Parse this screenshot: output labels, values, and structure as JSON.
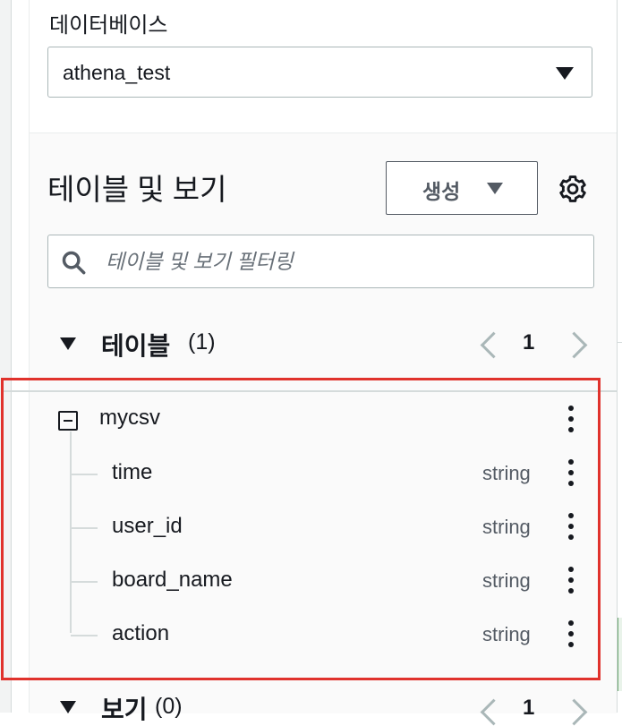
{
  "database": {
    "label": "데이터베이스",
    "selected": "athena_test"
  },
  "tables_panel": {
    "title": "테이블 및 보기",
    "create_label": "생성",
    "filter_placeholder": "테이블 및 보기 필터링"
  },
  "tables_group": {
    "title": "테이블",
    "count": "(1)",
    "page": "1",
    "table": {
      "name": "mycsv",
      "columns": [
        {
          "name": "time",
          "type": "string"
        },
        {
          "name": "user_id",
          "type": "string"
        },
        {
          "name": "board_name",
          "type": "string"
        },
        {
          "name": "action",
          "type": "string"
        }
      ]
    }
  },
  "views_group": {
    "title": "보기",
    "count": "(0)",
    "page": "1"
  },
  "colors": {
    "highlight": "#e0322c",
    "text": "#16191f",
    "muted": "#545b64",
    "border": "#aab7b8"
  },
  "icons": [
    "search-icon",
    "gear-icon",
    "caret-down-icon",
    "collapse-icon",
    "kebab-menu-icon",
    "chevron-left-icon",
    "chevron-right-icon"
  ]
}
